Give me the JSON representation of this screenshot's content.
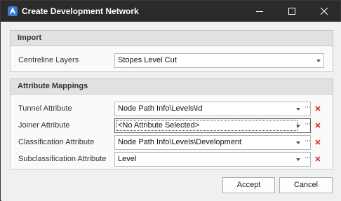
{
  "window": {
    "title": "Create Development Network",
    "controls": {
      "minimize_icon": "minimize-icon",
      "maximize_icon": "maximize-icon",
      "close_icon": "close-icon"
    }
  },
  "import_group": {
    "header": "Import",
    "centreline": {
      "label": "Centreline Layers",
      "value": "Stopes Level Cut"
    }
  },
  "attribute_group": {
    "header": "Attribute Mappings",
    "rows": [
      {
        "label": "Tunnel Attribute",
        "value": "Node Path Info\\Levels\\Id"
      },
      {
        "label": "Joiner Attribute",
        "value": "<No Attribute Selected>"
      },
      {
        "label": "Classification Attribute",
        "value": "Node Path Info\\Levels\\Development"
      },
      {
        "label": "Subclassification Attribute",
        "value": "Level"
      }
    ],
    "ellipsis_glyph": "···"
  },
  "buttons": {
    "accept": "Accept",
    "cancel": "Cancel"
  },
  "colors": {
    "titlebar": "#2b2b2b",
    "clear_icon": "#d03030",
    "app_icon": "#3a7bd5"
  }
}
